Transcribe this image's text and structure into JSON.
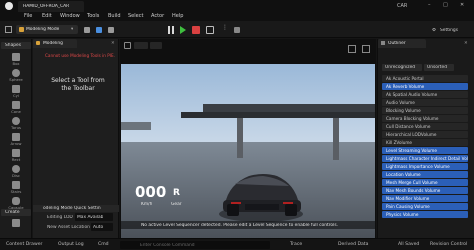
{
  "titlebar": {
    "project": "HAMID_OFFROA_CAR",
    "level": "CAR"
  },
  "menu": [
    "File",
    "Edit",
    "Window",
    "Tools",
    "Build",
    "Select",
    "Actor",
    "Help"
  ],
  "toolbar": {
    "mode": "Modeling Mode",
    "settings": "Settings"
  },
  "left_tools": {
    "section": "Shapes",
    "create": "Create",
    "items": [
      "Box",
      "Sphere",
      "Cyl",
      "Cone",
      "Torus",
      "Arrow",
      "Rect",
      "Disc",
      "Stairs",
      "Capsule"
    ]
  },
  "modeling": {
    "tab": "Modeling",
    "warning": "Cannot use Modeling Tools in PIE.",
    "prompt": "Select a Tool from the Toolbar",
    "quick_settings": "odeling Mode Quick Settin",
    "editing_lod_label": "Editing LOD",
    "editing_lod_value": "Max Availab",
    "new_asset_label": "New Asset Location",
    "new_asset_value": "Auto"
  },
  "viewport": {
    "speed_value": "000",
    "gear": "R",
    "speed_unit": "Km/h",
    "gear_label": "Gear",
    "banner": "No active Level Sequencer detected. Please edit a Level Sequence to enable full controls."
  },
  "outliner": {
    "tab": "Outliner",
    "filters": [
      "Unrecognized",
      "Unsorted"
    ],
    "items": [
      {
        "label": "Ak Acoustic Portal",
        "selected": false
      },
      {
        "label": "Ak Reverb Volume",
        "selected": true
      },
      {
        "label": "Ak Spatial Audio Volume",
        "selected": false
      },
      {
        "label": "Audio Volume",
        "selected": false
      },
      {
        "label": "Blocking Volume",
        "selected": false
      },
      {
        "label": "Camera Blocking Volume",
        "selected": false
      },
      {
        "label": "Cull Distance Volume",
        "selected": false
      },
      {
        "label": "Hierarchical LODVolume",
        "selected": false
      },
      {
        "label": "Kill ZVolume",
        "selected": false
      },
      {
        "label": "Level Streaming Volume",
        "selected": true
      },
      {
        "label": "Lightmass Character Indirect Detail Volume",
        "selected": true
      },
      {
        "label": "Lightmass Importance Volume",
        "selected": true
      },
      {
        "label": "Location Volume",
        "selected": true
      },
      {
        "label": "Mesh Merge Cull Volume",
        "selected": true
      },
      {
        "label": "Nav Mesh Bounds Volume",
        "selected": true
      },
      {
        "label": "Nav Modifier Volume",
        "selected": true
      },
      {
        "label": "Pain Causing Volume",
        "selected": true
      },
      {
        "label": "Physics Volume",
        "selected": true
      }
    ]
  },
  "statusbar": {
    "content_drawer": "Content Drawer",
    "output_log": "Output Log",
    "cmd": "Cmd",
    "console_placeholder": "Enter Console Command",
    "trace": "Trace",
    "derived_data": "Derived Data",
    "all_saved": "All Saved",
    "revision_control": "Revision Control"
  },
  "colors": {
    "accent_blue": "#2b5fb8",
    "warning_red": "#e04848",
    "play_green": "#3fbf3f",
    "stop_red": "#d94141"
  }
}
